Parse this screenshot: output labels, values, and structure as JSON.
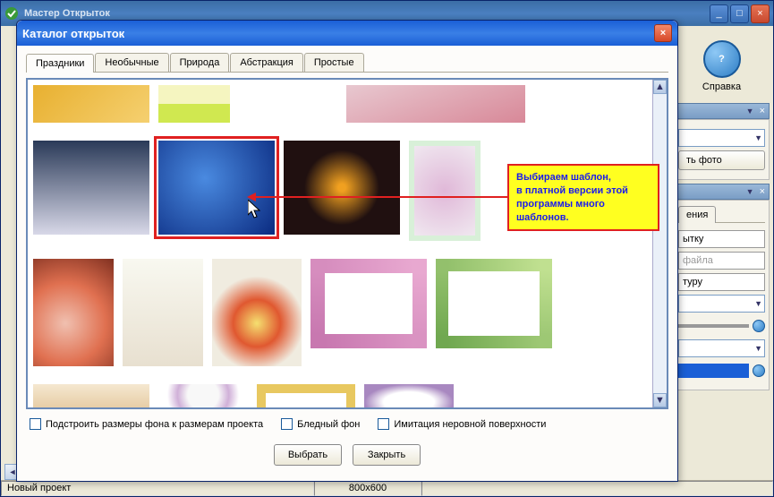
{
  "main_window": {
    "title": "Мастер Открыток"
  },
  "help": {
    "label": "Справка",
    "glyph": "?"
  },
  "right_fragments": {
    "btn_photo": "ть фото",
    "tab_ending": "ения",
    "input1": "ытку",
    "input2_placeholder": "файла",
    "input3": "туру"
  },
  "dialog": {
    "title": "Каталог открыток",
    "tabs": [
      "Праздники",
      "Необычные",
      "Природа",
      "Абстракция",
      "Простые"
    ],
    "active_tab": 0,
    "options": {
      "fit_bg": "Подстроить размеры фона к размерам проекта",
      "pale_bg": "Бледный фон",
      "rough_surface": "Имитация неровной поверхности"
    },
    "buttons": {
      "select": "Выбрать",
      "close": "Закрыть"
    }
  },
  "annotation": {
    "line1": "Выбираем шаблон,",
    "line2": "в платной версии этой",
    "line3": "программы много",
    "line4": "шаблонов."
  },
  "status": {
    "project": "Новый проект",
    "dimensions": "800x600"
  },
  "icons": {
    "minimize": "_",
    "maximize": "□",
    "close": "×",
    "down": "▼",
    "up": "▲",
    "left": "◄"
  }
}
